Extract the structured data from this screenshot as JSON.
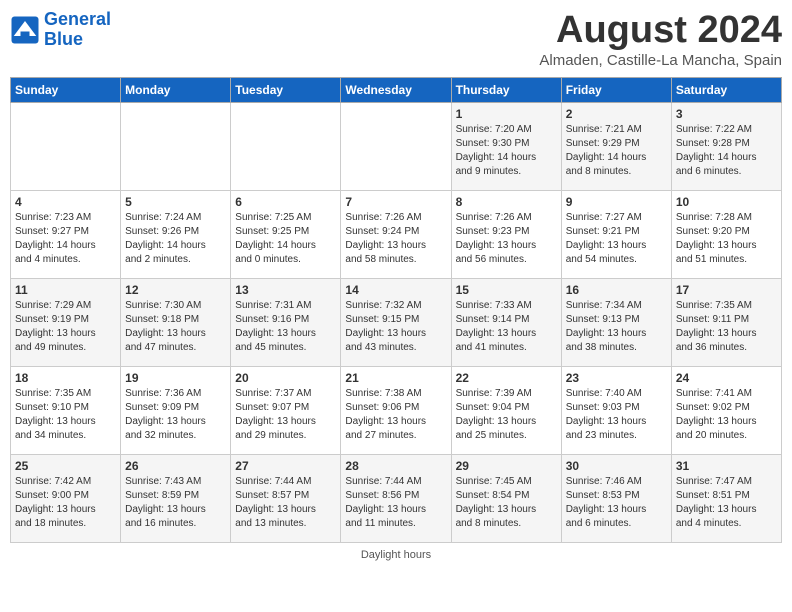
{
  "header": {
    "logo_line1": "General",
    "logo_line2": "Blue",
    "month_year": "August 2024",
    "location": "Almaden, Castille-La Mancha, Spain"
  },
  "days_of_week": [
    "Sunday",
    "Monday",
    "Tuesday",
    "Wednesday",
    "Thursday",
    "Friday",
    "Saturday"
  ],
  "weeks": [
    {
      "days": [
        {
          "num": "",
          "info": ""
        },
        {
          "num": "",
          "info": ""
        },
        {
          "num": "",
          "info": ""
        },
        {
          "num": "",
          "info": ""
        },
        {
          "num": "1",
          "info": "Sunrise: 7:20 AM\nSunset: 9:30 PM\nDaylight: 14 hours\nand 9 minutes."
        },
        {
          "num": "2",
          "info": "Sunrise: 7:21 AM\nSunset: 9:29 PM\nDaylight: 14 hours\nand 8 minutes."
        },
        {
          "num": "3",
          "info": "Sunrise: 7:22 AM\nSunset: 9:28 PM\nDaylight: 14 hours\nand 6 minutes."
        }
      ]
    },
    {
      "days": [
        {
          "num": "4",
          "info": "Sunrise: 7:23 AM\nSunset: 9:27 PM\nDaylight: 14 hours\nand 4 minutes."
        },
        {
          "num": "5",
          "info": "Sunrise: 7:24 AM\nSunset: 9:26 PM\nDaylight: 14 hours\nand 2 minutes."
        },
        {
          "num": "6",
          "info": "Sunrise: 7:25 AM\nSunset: 9:25 PM\nDaylight: 14 hours\nand 0 minutes."
        },
        {
          "num": "7",
          "info": "Sunrise: 7:26 AM\nSunset: 9:24 PM\nDaylight: 13 hours\nand 58 minutes."
        },
        {
          "num": "8",
          "info": "Sunrise: 7:26 AM\nSunset: 9:23 PM\nDaylight: 13 hours\nand 56 minutes."
        },
        {
          "num": "9",
          "info": "Sunrise: 7:27 AM\nSunset: 9:21 PM\nDaylight: 13 hours\nand 54 minutes."
        },
        {
          "num": "10",
          "info": "Sunrise: 7:28 AM\nSunset: 9:20 PM\nDaylight: 13 hours\nand 51 minutes."
        }
      ]
    },
    {
      "days": [
        {
          "num": "11",
          "info": "Sunrise: 7:29 AM\nSunset: 9:19 PM\nDaylight: 13 hours\nand 49 minutes."
        },
        {
          "num": "12",
          "info": "Sunrise: 7:30 AM\nSunset: 9:18 PM\nDaylight: 13 hours\nand 47 minutes."
        },
        {
          "num": "13",
          "info": "Sunrise: 7:31 AM\nSunset: 9:16 PM\nDaylight: 13 hours\nand 45 minutes."
        },
        {
          "num": "14",
          "info": "Sunrise: 7:32 AM\nSunset: 9:15 PM\nDaylight: 13 hours\nand 43 minutes."
        },
        {
          "num": "15",
          "info": "Sunrise: 7:33 AM\nSunset: 9:14 PM\nDaylight: 13 hours\nand 41 minutes."
        },
        {
          "num": "16",
          "info": "Sunrise: 7:34 AM\nSunset: 9:13 PM\nDaylight: 13 hours\nand 38 minutes."
        },
        {
          "num": "17",
          "info": "Sunrise: 7:35 AM\nSunset: 9:11 PM\nDaylight: 13 hours\nand 36 minutes."
        }
      ]
    },
    {
      "days": [
        {
          "num": "18",
          "info": "Sunrise: 7:35 AM\nSunset: 9:10 PM\nDaylight: 13 hours\nand 34 minutes."
        },
        {
          "num": "19",
          "info": "Sunrise: 7:36 AM\nSunset: 9:09 PM\nDaylight: 13 hours\nand 32 minutes."
        },
        {
          "num": "20",
          "info": "Sunrise: 7:37 AM\nSunset: 9:07 PM\nDaylight: 13 hours\nand 29 minutes."
        },
        {
          "num": "21",
          "info": "Sunrise: 7:38 AM\nSunset: 9:06 PM\nDaylight: 13 hours\nand 27 minutes."
        },
        {
          "num": "22",
          "info": "Sunrise: 7:39 AM\nSunset: 9:04 PM\nDaylight: 13 hours\nand 25 minutes."
        },
        {
          "num": "23",
          "info": "Sunrise: 7:40 AM\nSunset: 9:03 PM\nDaylight: 13 hours\nand 23 minutes."
        },
        {
          "num": "24",
          "info": "Sunrise: 7:41 AM\nSunset: 9:02 PM\nDaylight: 13 hours\nand 20 minutes."
        }
      ]
    },
    {
      "days": [
        {
          "num": "25",
          "info": "Sunrise: 7:42 AM\nSunset: 9:00 PM\nDaylight: 13 hours\nand 18 minutes."
        },
        {
          "num": "26",
          "info": "Sunrise: 7:43 AM\nSunset: 8:59 PM\nDaylight: 13 hours\nand 16 minutes."
        },
        {
          "num": "27",
          "info": "Sunrise: 7:44 AM\nSunset: 8:57 PM\nDaylight: 13 hours\nand 13 minutes."
        },
        {
          "num": "28",
          "info": "Sunrise: 7:44 AM\nSunset: 8:56 PM\nDaylight: 13 hours\nand 11 minutes."
        },
        {
          "num": "29",
          "info": "Sunrise: 7:45 AM\nSunset: 8:54 PM\nDaylight: 13 hours\nand 8 minutes."
        },
        {
          "num": "30",
          "info": "Sunrise: 7:46 AM\nSunset: 8:53 PM\nDaylight: 13 hours\nand 6 minutes."
        },
        {
          "num": "31",
          "info": "Sunrise: 7:47 AM\nSunset: 8:51 PM\nDaylight: 13 hours\nand 4 minutes."
        }
      ]
    }
  ],
  "footer": "Daylight hours"
}
